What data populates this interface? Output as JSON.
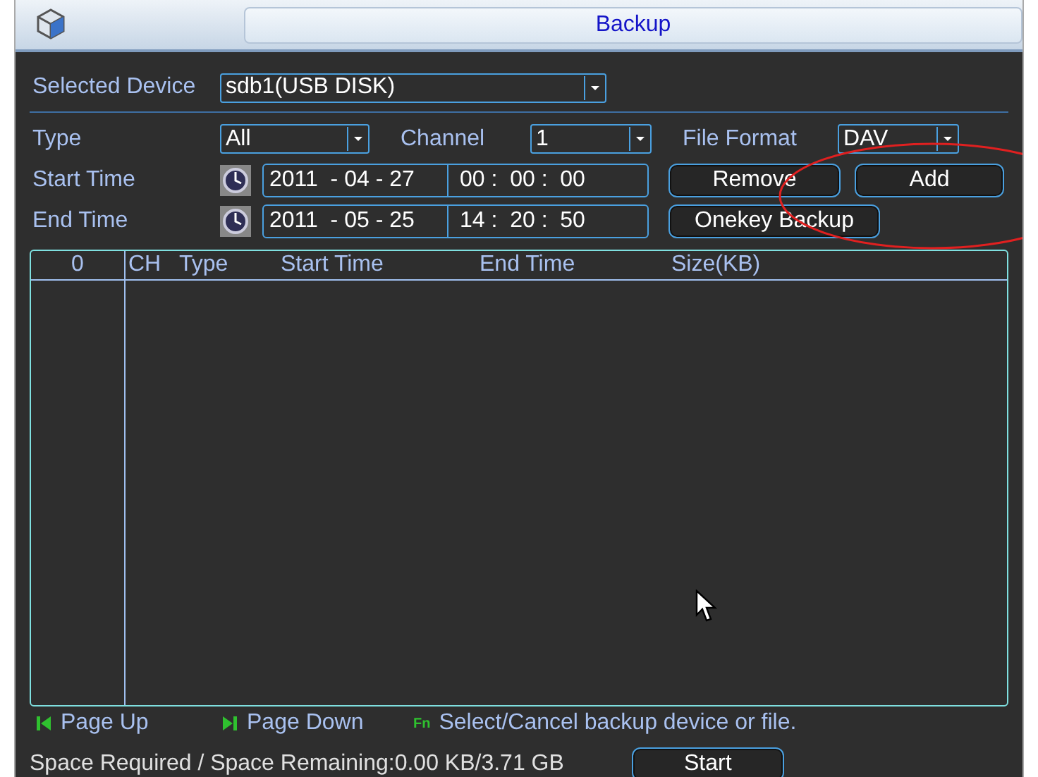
{
  "window": {
    "title": "Backup"
  },
  "selected_device": {
    "label": "Selected Device",
    "value": "sdb1(USB DISK)"
  },
  "type": {
    "label": "Type",
    "value": "All"
  },
  "channel": {
    "label": "Channel",
    "value": "1"
  },
  "file_format": {
    "label": "File Format",
    "value": "DAV"
  },
  "start_time": {
    "label": "Start Time",
    "date": "2011  - 04 - 27",
    "time": "00 :  00 :  00"
  },
  "end_time": {
    "label": "End Time",
    "date": "2011  - 05 - 25",
    "time": "14 :  20 :  50"
  },
  "buttons": {
    "remove": "Remove",
    "add": "Add",
    "onekey": "Onekey Backup",
    "start": "Start"
  },
  "table": {
    "count": "0",
    "columns": [
      "CH",
      "Type",
      "Start Time",
      "End Time",
      "Size(KB)"
    ]
  },
  "footer": {
    "page_up": "Page Up",
    "page_down": "Page Down",
    "fn": "Fn",
    "hint": "Select/Cancel backup device or file.",
    "space": "Space Required / Space Remaining:0.00 KB/3.71 GB"
  }
}
